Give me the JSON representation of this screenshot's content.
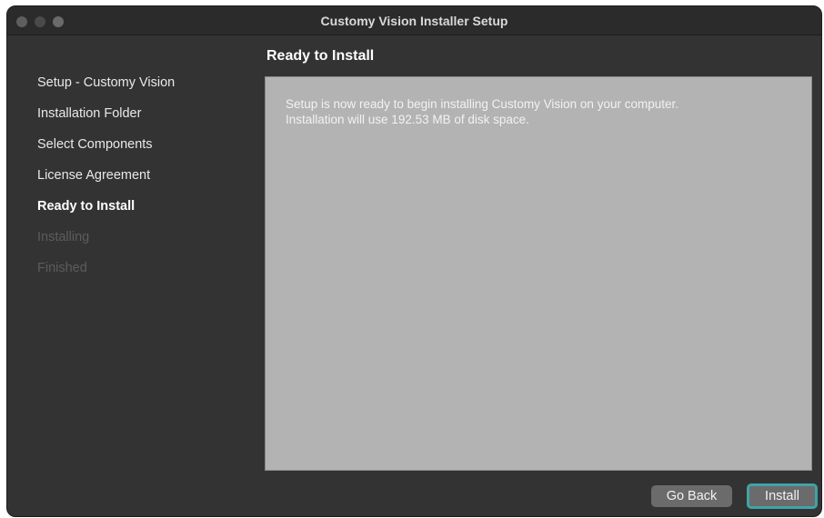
{
  "window": {
    "title": "Customy Vision Installer Setup"
  },
  "sidebar": {
    "steps": [
      {
        "label": "Setup - Customy Vision",
        "state": "done"
      },
      {
        "label": "Installation Folder",
        "state": "done"
      },
      {
        "label": "Select Components",
        "state": "done"
      },
      {
        "label": "License Agreement",
        "state": "done"
      },
      {
        "label": "Ready to Install",
        "state": "active"
      },
      {
        "label": "Installing",
        "state": "pending"
      },
      {
        "label": "Finished",
        "state": "pending"
      }
    ]
  },
  "main": {
    "heading": "Ready to Install",
    "message_line1": "Setup is now ready to begin installing Customy Vision on your computer.",
    "message_line2": "Installation will use 192.53 MB of disk space."
  },
  "buttons": {
    "back_label": "Go Back",
    "install_label": "Install"
  },
  "colors": {
    "window_bg": "#333333",
    "content_bg": "#b3b3b3",
    "focus_ring": "#3fa3a6",
    "pending_text": "#5c5c5c"
  }
}
